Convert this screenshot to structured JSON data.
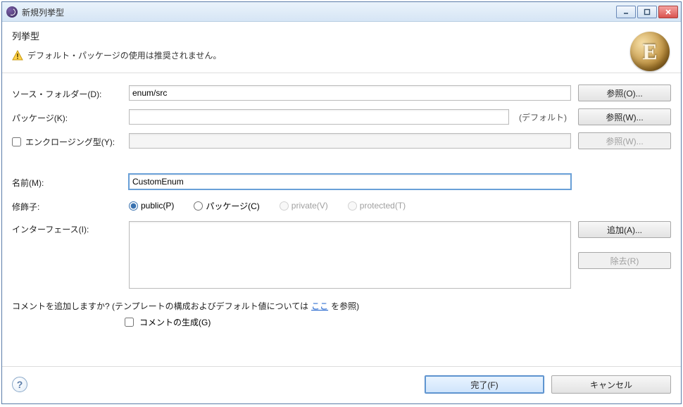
{
  "window": {
    "title": "新規列挙型"
  },
  "header": {
    "title": "列挙型",
    "warning": "デフォルト・パッケージの使用は推奨されません。",
    "logo_letter": "E"
  },
  "form": {
    "source_folder": {
      "label": "ソース・フォルダー(D):",
      "value": "enum/src",
      "browse": "参照(O)..."
    },
    "package": {
      "label": "パッケージ(K):",
      "value": "",
      "default_note": "(デフォルト)",
      "browse": "参照(W)..."
    },
    "enclosing": {
      "label": "エンクロージング型(Y):",
      "value": "",
      "browse": "参照(W)..."
    },
    "name": {
      "label": "名前(M):",
      "value": "CustomEnum"
    },
    "modifiers": {
      "label": "修飾子:",
      "options": {
        "public": "public(P)",
        "package": "パッケージ(C)",
        "private": "private(V)",
        "protected": "protected(T)"
      }
    },
    "interfaces": {
      "label": "インターフェース(I):",
      "add": "追加(A)...",
      "remove": "除去(R)"
    },
    "comments": {
      "question_before": "コメントを追加しますか? (テンプレートの構成およびデフォルト値については",
      "link": "ここ",
      "question_after": "を参照)",
      "generate": "コメントの生成(G)"
    }
  },
  "footer": {
    "finish": "完了(F)",
    "cancel": "キャンセル"
  }
}
